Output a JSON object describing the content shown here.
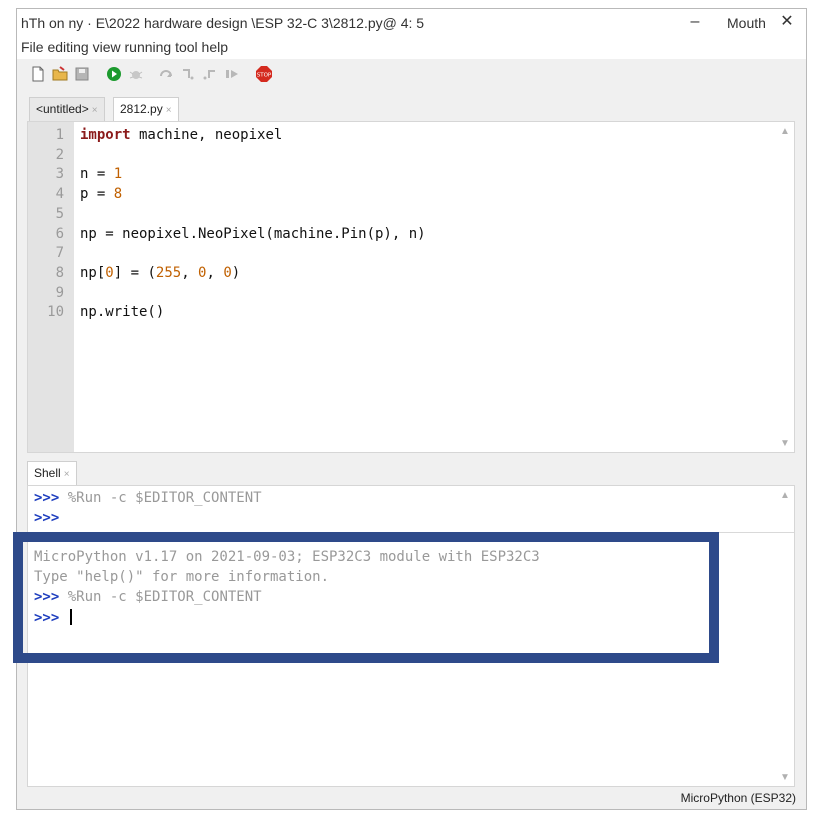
{
  "window": {
    "title": "hTh on ny · E\\2022 hardware design \\ESP 32-C 3\\2812.py@ 4: 5",
    "minimize_glyph": "–",
    "max_label": "Mouth",
    "close_glyph": "✕"
  },
  "menu": {
    "text": "File editing view running tool help"
  },
  "toolbar": {
    "icons": [
      "new-file-icon",
      "open-folder-icon",
      "save-icon",
      "run-icon",
      "debug-icon",
      "step-over-icon",
      "step-into-icon",
      "step-out-icon",
      "resume-icon",
      "stop-icon"
    ],
    "stop_label": "STOP",
    "colors": {
      "run": "#1c9a2e",
      "stop": "#d42a1e",
      "disabled": "#b8b8b8"
    }
  },
  "tabs": [
    {
      "label": "<untitled>",
      "close": "×"
    },
    {
      "label": "2812.py",
      "close": "×"
    }
  ],
  "editor": {
    "lines": [
      {
        "n": "1",
        "parts": [
          {
            "t": "import",
            "c": "kw"
          },
          {
            "t": " machine, neopixel",
            "c": ""
          }
        ]
      },
      {
        "n": "2",
        "parts": []
      },
      {
        "n": "3",
        "parts": [
          {
            "t": "n = ",
            "c": ""
          },
          {
            "t": "1",
            "c": "num"
          }
        ]
      },
      {
        "n": "4",
        "parts": [
          {
            "t": "p = ",
            "c": ""
          },
          {
            "t": "8",
            "c": "num"
          }
        ]
      },
      {
        "n": "5",
        "parts": []
      },
      {
        "n": "6",
        "parts": [
          {
            "t": "np = neopixel.NeoPixel(machine.Pin(p), n)",
            "c": ""
          }
        ]
      },
      {
        "n": "7",
        "parts": []
      },
      {
        "n": "8",
        "parts": [
          {
            "t": "np[",
            "c": ""
          },
          {
            "t": "0",
            "c": "num"
          },
          {
            "t": "] = (",
            "c": ""
          },
          {
            "t": "255",
            "c": "num"
          },
          {
            "t": ", ",
            "c": ""
          },
          {
            "t": "0",
            "c": "num"
          },
          {
            "t": ", ",
            "c": ""
          },
          {
            "t": "0",
            "c": "num"
          },
          {
            "t": ")",
            "c": ""
          }
        ]
      },
      {
        "n": "9",
        "parts": []
      },
      {
        "n": "10",
        "parts": [
          {
            "t": "np.write()",
            "c": ""
          }
        ]
      }
    ]
  },
  "shell": {
    "tab": {
      "label": "Shell",
      "close": "×"
    },
    "prompt": ">>>",
    "lines": [
      {
        "prompt": true,
        "text": " %Run -c $EDITOR_CONTENT"
      },
      {
        "prompt": true,
        "text": ""
      },
      {
        "prompt": false,
        "text": "MicroPython v1.17 on 2021-09-03; ESP32C3 module with ESP32C3"
      },
      {
        "prompt": false,
        "text": "Type \"help()\" for more information."
      },
      {
        "prompt": true,
        "text": " %Run -c $EDITOR_CONTENT"
      },
      {
        "prompt": true,
        "text": " ",
        "cursor": true
      }
    ]
  },
  "status": {
    "text": "MicroPython (ESP32)"
  },
  "colors": {
    "highlight_border": "#2e4a8a",
    "keyword": "#8b1a1a",
    "number": "#c06000",
    "prompt": "#1f3fbf"
  }
}
